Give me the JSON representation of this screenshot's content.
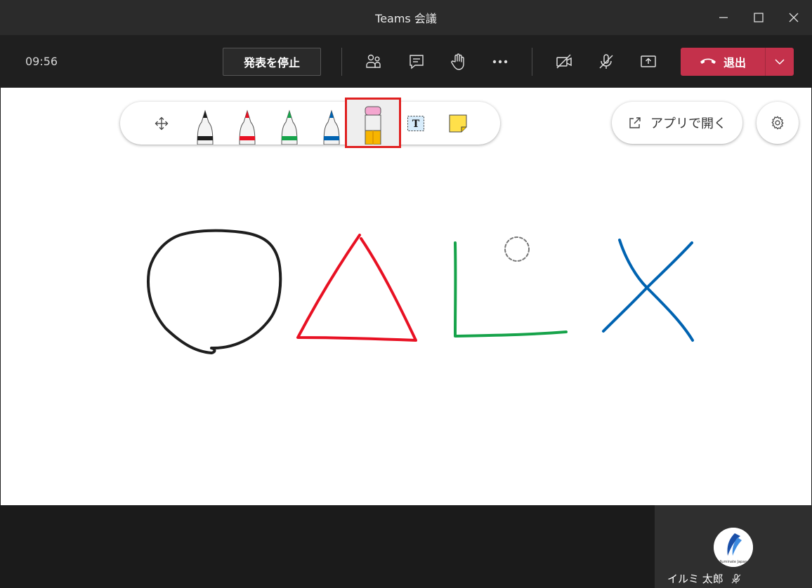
{
  "window": {
    "title": "Teams 会議"
  },
  "meeting": {
    "time": "09:56",
    "stop_presenting_label": "発表を停止",
    "leave_label": "退出"
  },
  "whiteboard": {
    "open_in_app_label": "アプリで開く",
    "active_tool": "eraser",
    "tools": [
      "move",
      "pen-black",
      "pen-red",
      "pen-green",
      "pen-blue",
      "eraser",
      "text",
      "sticky-note"
    ]
  },
  "colors": {
    "leave": "#c4314b",
    "pen_black": "#1e1e1e",
    "pen_red": "#e81123",
    "pen_green": "#16a34a",
    "pen_blue": "#0063b1",
    "highlight": "#e02020"
  },
  "participant": {
    "name": "イルミ 太郎",
    "avatar_text": "Iluminate Japan"
  }
}
